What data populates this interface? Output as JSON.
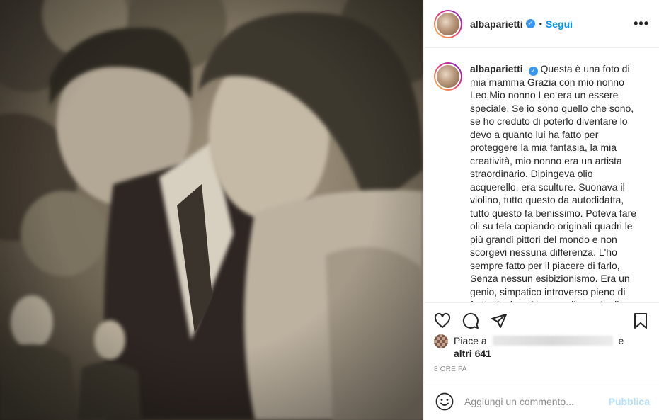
{
  "post": {
    "username": "albaparietti",
    "follow_label": "Segui",
    "dot": "•",
    "more_label": "•••",
    "verified_glyph": "✓",
    "caption": "Questa è una foto di mia mamma Grazia con mio nonno Leo.Mio nonno Leo era un essere speciale. Se io sono quello che sono, se ho creduto di poterlo diventare lo devo a quanto lui ha fatto per proteggere la mia fantasia, la mia creatività, mio nonno era un artista straordinario. Dipingeva olio acquerello, era sculture. Suonava il violino, tutto questo da autodidatta, tutto questo fa benissimo. Poteva fare oli su tela copiando originali quadri le più grandi pittori del mondo e non scorgevi nessuna differenza. L'ho sempre fatto per il piacere di farlo, Senza nessun esibizionismo. Era un genio, simpatico introverso pieno di fantasia, in cui trovava l'energia di vivere",
    "likes_prefix": "Piace a",
    "likes_suffix": "e",
    "likes_count": "altri 641",
    "time_ago": "8 ORE FA",
    "comment_placeholder": "Aggiungi un commento...",
    "publish_label": "Pubblica"
  },
  "icons": {
    "like": "heart-icon",
    "comment": "comment-bubble-icon",
    "share": "paper-plane-icon",
    "save": "bookmark-icon",
    "emoji": "smiley-icon"
  },
  "colors": {
    "link_blue": "#0095f6",
    "publish_disabled": "#b2dffc",
    "verified_blue": "#3897f0",
    "muted_text": "#8e8e8e"
  }
}
